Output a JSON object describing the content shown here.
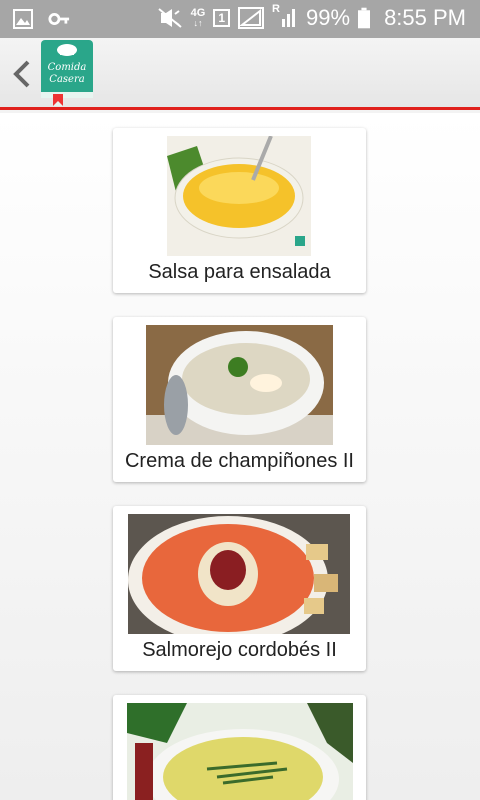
{
  "status_bar": {
    "network": "4G",
    "sim_slot": "1",
    "roaming": "R",
    "battery": "99%",
    "time": "8:55 PM",
    "icons": [
      "image-icon",
      "key-icon",
      "mute-icon",
      "signal-icon",
      "battery-icon"
    ]
  },
  "app": {
    "logo_text": "Comida Casera",
    "accent_color": "#e0201c"
  },
  "recipes": [
    {
      "title": "Salsa para ensalada"
    },
    {
      "title": "Crema de champiñones II"
    },
    {
      "title": "Salmorejo cordobés II"
    },
    {
      "title": ""
    }
  ]
}
